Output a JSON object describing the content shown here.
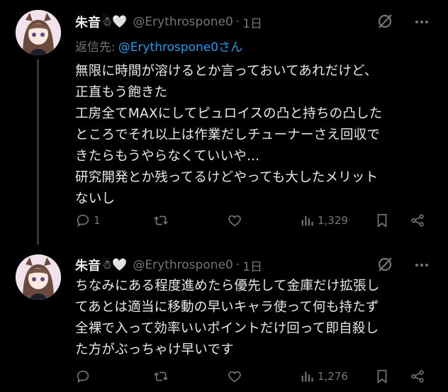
{
  "tweets": [
    {
      "author": {
        "name": "朱音",
        "emoji": "☃🤍",
        "handle": "@Erythrospone0",
        "time": "1日"
      },
      "reply_to": {
        "label": "返信先:",
        "mention": "@Erythrospone0さん"
      },
      "text": "無限に時間が溶けるとか言っておいてあれだけど、\n正直もう飽きた\n工房全てMAXにしてピュロイスの凸と持ちの凸した\nところでそれ以上は作業だしチューナーさえ回収で\nきたらもうやらなくていいや...\n研究開発とか残ってるけどやっても大したメリット\nないし",
      "actions": {
        "replies": "1",
        "reposts": "",
        "likes": "",
        "views": "1,329"
      }
    },
    {
      "author": {
        "name": "朱音",
        "emoji": "☃🤍",
        "handle": "@Erythrospone0",
        "time": "1日"
      },
      "text": "ちなみにある程度進めたら優先して金庫だけ拡張し\nてあとは適当に移動の早いキャラ使って何も持たず\n全裸で入って効率いいポイントだけ回って即自殺し\nた方がぶっちゃけ早いです",
      "actions": {
        "replies": "",
        "reposts": "",
        "likes": "",
        "views": "1,276"
      }
    }
  ],
  "separator": "·",
  "colors": {
    "background": "#000000",
    "text": "#e7e9ea",
    "muted": "#71767b",
    "link": "#1d9bf0"
  },
  "icons": [
    "grok-icon",
    "more-icon",
    "reply-icon",
    "repost-icon",
    "like-icon",
    "views-icon",
    "bookmark-icon",
    "share-icon"
  ]
}
